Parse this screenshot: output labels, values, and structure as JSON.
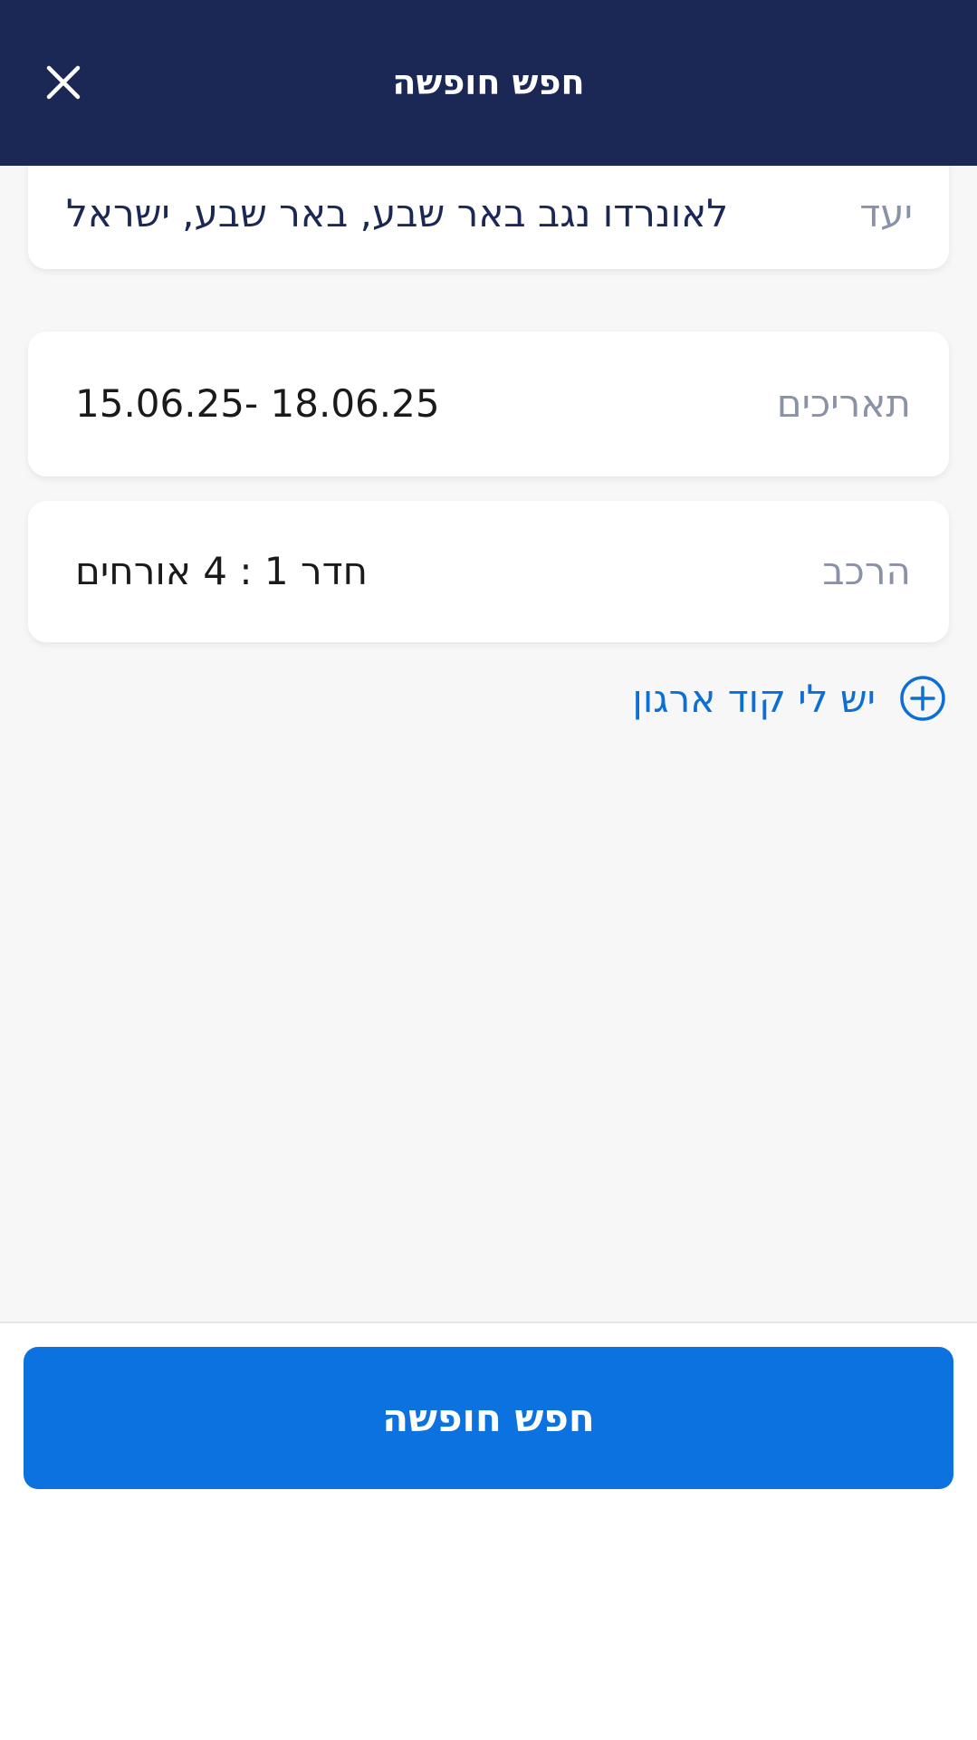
{
  "header": {
    "title": "חפש חופשה",
    "close_icon": "close-icon"
  },
  "destination": {
    "label": "יעד",
    "value": "לאונרדו נגב באר שבע, באר שבע, ישראל"
  },
  "dates": {
    "label": "תאריכים",
    "value": "15.06.25- 18.06.25"
  },
  "composition": {
    "label": "הרכב",
    "value": "חדר 1 : 4 אורחים"
  },
  "org_code": {
    "label": "יש לי קוד ארגון",
    "icon": "plus-circle-icon"
  },
  "footer": {
    "search_button": "חפש חופשה"
  },
  "colors": {
    "header_bg": "#1b2856",
    "accent": "#0b72df",
    "link": "#0b6fd6",
    "label_gray": "#8a92a8",
    "content_bg": "#f7f7f7"
  }
}
